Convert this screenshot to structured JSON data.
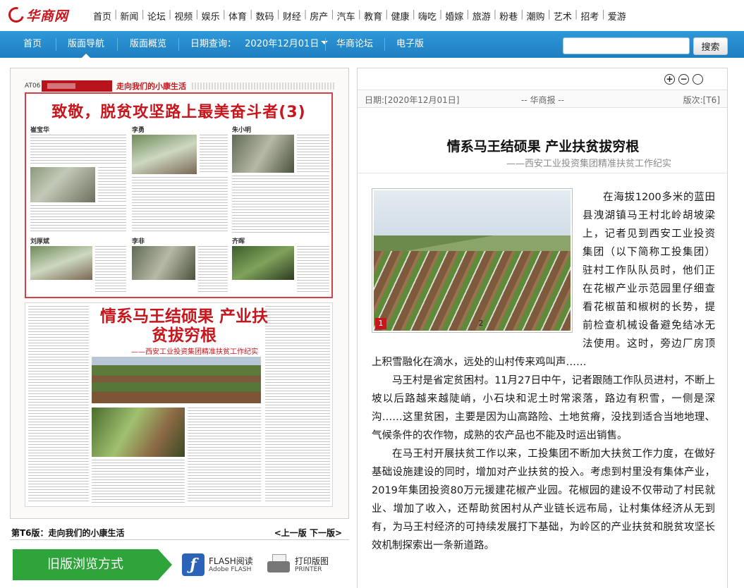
{
  "logo": {
    "text": "华商网"
  },
  "channels": [
    "首页",
    "新闻",
    "论坛",
    "视频",
    "娱乐",
    "体育",
    "数码",
    "财经",
    "房产",
    "汽车",
    "教育",
    "健康",
    "嗨吃",
    "婚嫁",
    "旅游",
    "粉巷",
    "潮购",
    "艺术",
    "招考",
    "爱游"
  ],
  "nav": {
    "home": "首页",
    "layout_nav": "版面导航",
    "overview": "版面概览",
    "date_label": "日期查询：",
    "date_value": "2020年12月01日",
    "forum": "华商论坛",
    "epaper": "电子版",
    "search_value": "",
    "search_button": "搜索"
  },
  "page_image": {
    "code": "AT06",
    "section": "走向我们的小康生活",
    "headline": "致敬，脱贫攻坚路上最美奋斗者(3)",
    "names": [
      "崔宝华",
      "李勇",
      "朱小明",
      "刘厚斌",
      "李非",
      "齐晖"
    ],
    "story_title": "情系马王结硕果 产业扶贫拔穷根",
    "story_subtitle": "——西安工业投资集团精准扶贫工作纪实"
  },
  "page_info": {
    "edition_label": "第T6版：",
    "edition_name": "走向我们的小康生活",
    "prev": "<上一版",
    "next": "下一版>"
  },
  "tools": {
    "old_view": "旧版浏览方式",
    "flash_label": "FLASH阅读",
    "flash_sub": "Adobe FLASH",
    "print_label": "打印版图",
    "print_sub": "PRINTER"
  },
  "article": {
    "date": "日期:[2020年12月01日]",
    "paper": "-- 华商报 --",
    "version": "版次:[T6]",
    "title": "情系马王结硕果 产业扶贫拔穷根",
    "subtitle": "——西安工业投资集团精准扶贫工作纪实",
    "figure_labels": [
      "1",
      "2"
    ],
    "paragraphs": [
      "在海拔1200多米的蓝田县洩湖镇马王村北岭胡坡梁上，记者见到西安工业投资集团（以下简称工投集团）驻村工作队队员时，他们正在花椒产业示范园里仔细查看花椒苗和椒树的长势，提前检查机械设备避免结冰无法使用。这时，旁边厂房顶上积雪融化在滴水，远处的山村传来鸡叫声……",
      "马王村是省定贫困村。11月27日中午，记者跟随工作队员进村，不断上坡以后路越来越陡峭，小石块和泥土时常滚落，路边有积雪，一侧是深沟……这里贫困，主要是因为山高路险、土地贫瘠，没找到适合当地地理、气候条件的农作物，成熟的农产品也不能及时运出销售。",
      "在马王村开展扶贫工作以来，工投集团不断加大扶贫工作力度，在做好基础设施建设的同时，增加对产业扶贫的投入。考虑到村里没有集体产业，2019年集团投资80万元援建花椒产业园。花椒园的建设不仅带动了村民就业、增加了收入，还帮助贫困村从产业链长远布局，让村集体经济从无到有，为马王村经济的可持续发展打下基础，为岭区的产业扶贫和脱贫攻坚长效机制探索出一条新道路。"
    ]
  }
}
